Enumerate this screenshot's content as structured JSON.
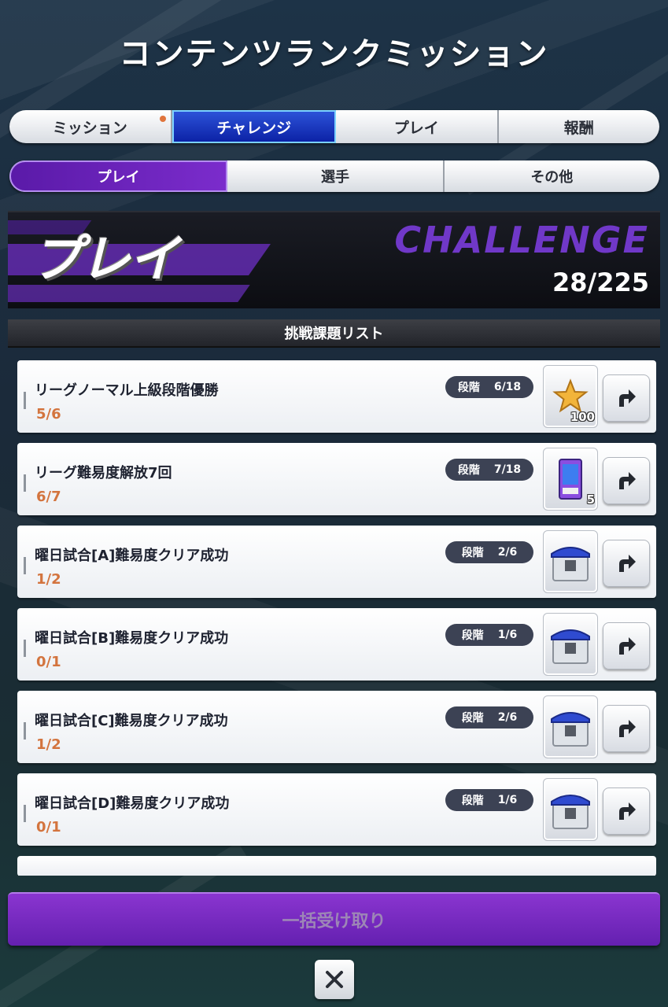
{
  "header": {
    "title": "コンテンツランクミッション"
  },
  "main_tabs": [
    {
      "label": "ミッション",
      "has_notification": true
    },
    {
      "label": "チャレンジ",
      "active": true
    },
    {
      "label": "プレイ"
    },
    {
      "label": "報酬"
    }
  ],
  "sub_tabs": [
    {
      "label": "プレイ",
      "active": true
    },
    {
      "label": "選手"
    },
    {
      "label": "その他"
    }
  ],
  "banner": {
    "label": "プレイ",
    "challenge": "CHALLENGE",
    "count": "28/225"
  },
  "list_header": "挑戦課題リスト",
  "missions": [
    {
      "name": "リーグノーマル上級段階優勝",
      "progress": "5/6",
      "stage_label": "段階",
      "stage": "6/18",
      "reward_icon": "star-icon",
      "reward_amount": "100"
    },
    {
      "name": "リーグ難易度解放7回",
      "progress": "6/7",
      "stage_label": "段階",
      "stage": "7/18",
      "reward_icon": "card-pack-icon",
      "reward_amount": "5"
    },
    {
      "name": "曜日試合[A]難易度クリア成功",
      "progress": "1/2",
      "stage_label": "段階",
      "stage": "2/6",
      "reward_icon": "crate-icon",
      "reward_amount": ""
    },
    {
      "name": "曜日試合[B]難易度クリア成功",
      "progress": "0/1",
      "stage_label": "段階",
      "stage": "1/6",
      "reward_icon": "crate-icon",
      "reward_amount": ""
    },
    {
      "name": "曜日試合[C]難易度クリア成功",
      "progress": "1/2",
      "stage_label": "段階",
      "stage": "2/6",
      "reward_icon": "crate-icon",
      "reward_amount": ""
    },
    {
      "name": "曜日試合[D]難易度クリア成功",
      "progress": "0/1",
      "stage_label": "段階",
      "stage": "1/6",
      "reward_icon": "crate-icon",
      "reward_amount": ""
    }
  ],
  "footer": {
    "bulk_receive": "一括受け取り"
  },
  "colors": {
    "accent_purple": "#6a24b8",
    "active_tab_blue": "#1632c0",
    "progress_orange": "#d3743e"
  }
}
